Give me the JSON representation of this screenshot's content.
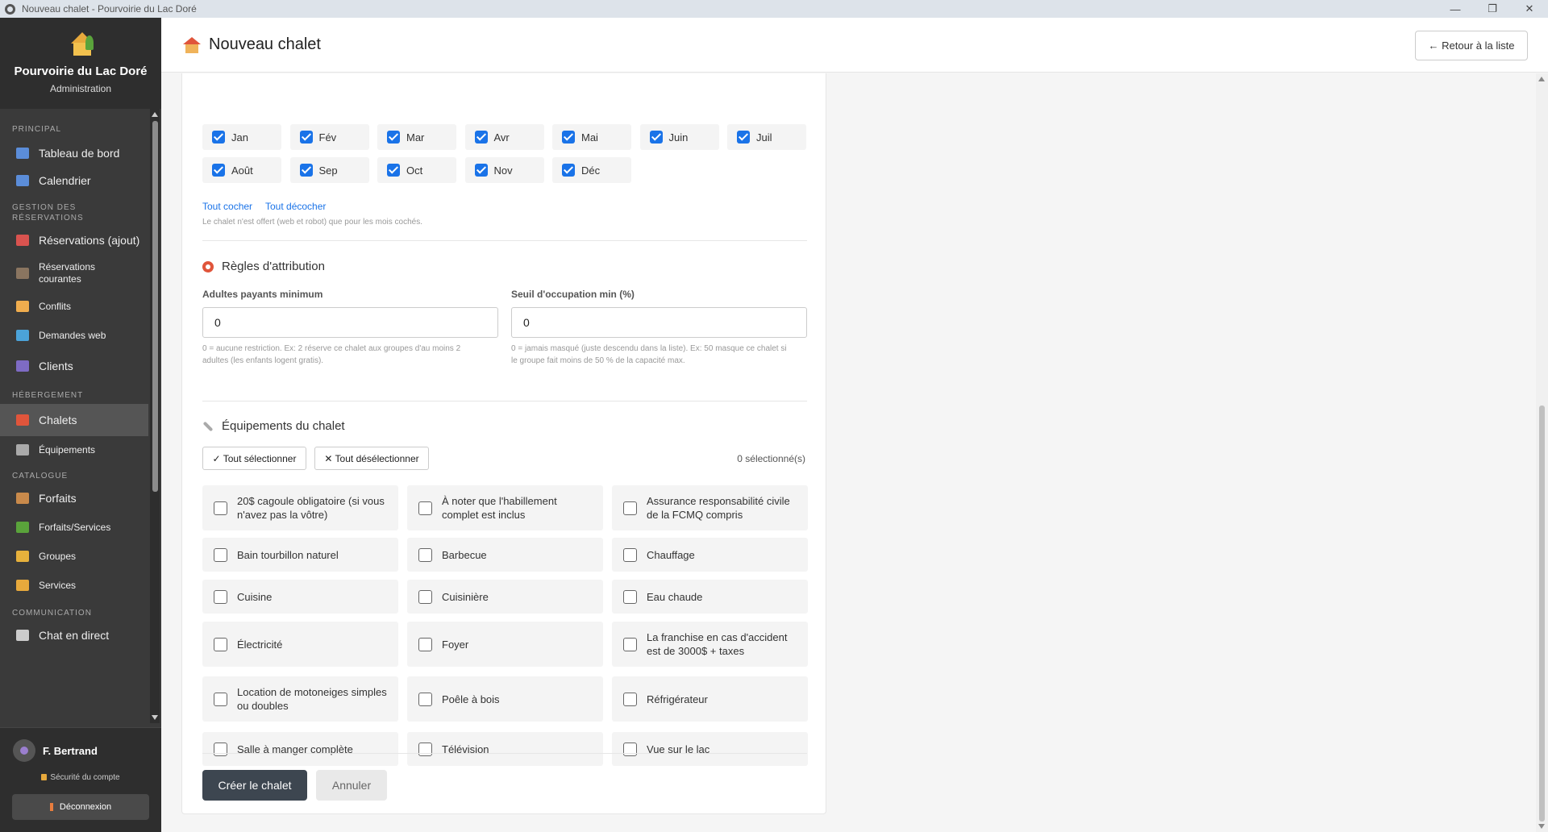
{
  "window": {
    "title": "Nouveau chalet - Pourvoirie du Lac Doré",
    "minimize": "—",
    "maximize": "❐",
    "close": "✕"
  },
  "brand": {
    "title": "Pourvoirie du Lac Doré",
    "subtitle": "Administration"
  },
  "sidebar": {
    "sections": {
      "principal": "PRINCIPAL",
      "reservations": "GESTION DES RÉSERVATIONS",
      "hebergement": "HÉBERGEMENT",
      "catalogue": "CATALOGUE",
      "communication": "COMMUNICATION"
    },
    "items": [
      {
        "label": "Tableau de bord",
        "color": "#5b8dd9"
      },
      {
        "label": "Calendrier",
        "color": "#5b8dd9"
      },
      {
        "label": "Réservations (ajout)",
        "color": "#d9534f"
      },
      {
        "label": "Réservations courantes",
        "color": "#8a7560"
      },
      {
        "label": "Conflits",
        "color": "#f0ad4e"
      },
      {
        "label": "Demandes web",
        "color": "#4ba3d9"
      },
      {
        "label": "Clients",
        "color": "#7e6bc4"
      },
      {
        "label": "Chalets",
        "color": "#e0553b"
      },
      {
        "label": "Équipements",
        "color": "#aaaaaa"
      },
      {
        "label": "Forfaits",
        "color": "#c98a4b"
      },
      {
        "label": "Forfaits/Services",
        "color": "#5aa33b"
      },
      {
        "label": "Groupes",
        "color": "#e7b13c"
      },
      {
        "label": "Services",
        "color": "#e7a93c"
      },
      {
        "label": "Chat en direct",
        "color": "#cccccc"
      }
    ]
  },
  "user": {
    "name": "F. Bertrand",
    "account_security": "Sécurité du compte",
    "logout": "Déconnexion"
  },
  "header": {
    "title": "Nouveau chalet",
    "back_label": "← Retour à la liste"
  },
  "months": {
    "items": [
      "Jan",
      "Fév",
      "Mar",
      "Avr",
      "Mai",
      "Juin",
      "Juil",
      "Août",
      "Sep",
      "Oct",
      "Nov",
      "Déc"
    ],
    "check_all": "Tout cocher",
    "uncheck_all": "Tout décocher",
    "hint": "Le chalet n'est offert (web et robot) que pour les mois cochés."
  },
  "rules": {
    "title": "Règles d'attribution",
    "adults_label": "Adultes payants minimum",
    "adults_value": "0",
    "adults_hint_1": "0 = aucune restriction. Ex: 2 réserve ce chalet aux groupes d'au moins 2",
    "adults_hint_2": "adultes (les enfants logent gratis).",
    "occupancy_label": "Seuil d'occupation min (%)",
    "occupancy_value": "0",
    "occupancy_hint_1": "0 = jamais masqué (juste descendu dans la liste). Ex: 50 masque ce chalet si",
    "occupancy_hint_2": "le groupe fait moins de 50 % de la capacité max."
  },
  "equipment": {
    "title": "Équipements du chalet",
    "select_all": "✓ Tout sélectionner",
    "deselect_all": "✕ Tout désélectionner",
    "count": "0 sélectionné(s)",
    "items": [
      "20$ cagoule obligatoire (si vous n'avez pas la vôtre)",
      "À noter que l'habillement complet est inclus",
      "Assurance responsabilité civile de la FCMQ compris",
      "Bain tourbillon naturel",
      "Barbecue",
      "Chauffage",
      "Cuisine",
      "Cuisinière",
      "Eau chaude",
      "Électricité",
      "Foyer",
      "La franchise en cas d'accident est de 3000$ + taxes",
      "Location de motoneiges simples ou doubles",
      "Poêle à bois",
      "Réfrigérateur",
      "Salle à manger complète",
      "Télévision",
      "Vue sur le lac"
    ]
  },
  "actions": {
    "create": "Créer le chalet",
    "cancel": "Annuler"
  }
}
